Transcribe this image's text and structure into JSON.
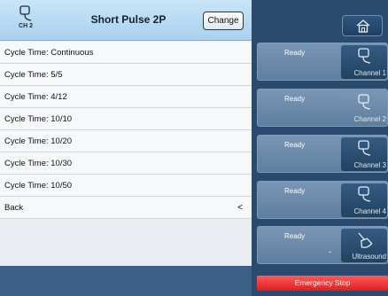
{
  "header": {
    "channel_badge": "CH 2",
    "title": "Short Pulse 2P",
    "change_label": "Change"
  },
  "list": {
    "items": [
      {
        "label": "Cycle Time: Continuous"
      },
      {
        "label": "Cycle Time: 5/5"
      },
      {
        "label": "Cycle Time: 4/12"
      },
      {
        "label": "Cycle Time: 10/10"
      },
      {
        "label": "Cycle Time: 10/20"
      },
      {
        "label": "Cycle Time: 10/30"
      },
      {
        "label": "Cycle Time: 10/50"
      }
    ],
    "back_label": "Back",
    "back_chevron": "<"
  },
  "channels": [
    {
      "status": "Ready",
      "name": "Channel 1",
      "icon": "electrode-icon"
    },
    {
      "status": "Ready",
      "name": "Channel 2",
      "icon": "electrode-icon"
    },
    {
      "status": "Ready",
      "name": "Channel 3",
      "icon": "electrode-icon"
    },
    {
      "status": "Ready",
      "name": "Channel 4",
      "icon": "electrode-icon"
    },
    {
      "status": "Ready",
      "name": "Ultrasound",
      "icon": "ultrasound-head-icon",
      "value": "-"
    }
  ],
  "emergency_stop_label": "Emergency Stop",
  "colors": {
    "header_bg": "#b8dcf3",
    "panel_bg": "#2b4a6e",
    "emergency": "#ef2b2b"
  }
}
